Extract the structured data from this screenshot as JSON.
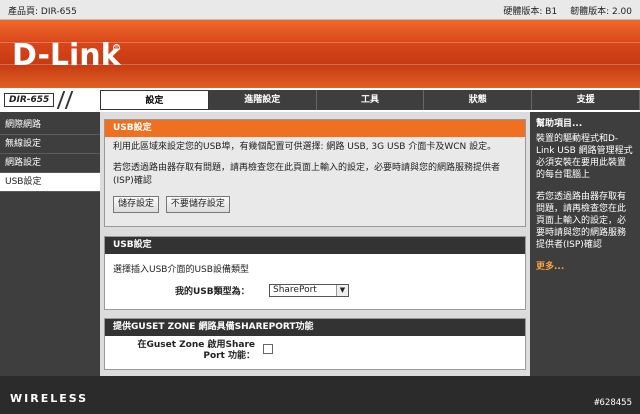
{
  "topbar": {
    "product": "產品頁: DIR-655",
    "hardware": "硬體版本: B1",
    "firmware": "韌體版本: 2.00"
  },
  "banner": {
    "logo": "D-Link",
    "logo_mark": "®"
  },
  "model": "DIR-655",
  "tabs": [
    {
      "label": "設定"
    },
    {
      "label": "進階設定"
    },
    {
      "label": "工具"
    },
    {
      "label": "狀態"
    },
    {
      "label": "支援"
    }
  ],
  "sidebar": {
    "items": [
      {
        "label": "網際網路"
      },
      {
        "label": "無線設定"
      },
      {
        "label": "網路設定"
      },
      {
        "label": "USB設定"
      }
    ]
  },
  "intro": {
    "title": "USB設定",
    "text1": "利用此區域來設定您的USB埠，有幾個配置可供選擇: 網路 USB, 3G USB 介面卡及WCN 設定。",
    "text2": "若您透過路由器存取有問題，請再檢查您在此頁面上輸入的設定，必要時請與您的網路服務提供者(ISP)確認",
    "save_label": "儲存設定",
    "nosave_label": "不要儲存設定"
  },
  "usb": {
    "title": "USB設定",
    "desc": "選擇插入USB介面的USB設備類型",
    "type_label": "我的USB類型為：",
    "type_value": "SharePort"
  },
  "guest": {
    "title": "提供GUSET ZONE 網路具備SHAREPORT功能",
    "label_line1": "在Guset Zone 啟用Share",
    "label_line2": "Port 功能："
  },
  "help": {
    "title": "幫助項目...",
    "p1": "裝置的驅動程式和D-Link USB 網路管理程式必須安裝在要用此裝置的每台電腦上",
    "p2": "若您透過路由器存取有問題，請再檢查您在此頁面上輸入的設定，必要時請與您的網路服務提供者(ISP)確認",
    "more": "更多..."
  },
  "footer": {
    "brand": "WIRELESS",
    "watermark": "#628455"
  }
}
